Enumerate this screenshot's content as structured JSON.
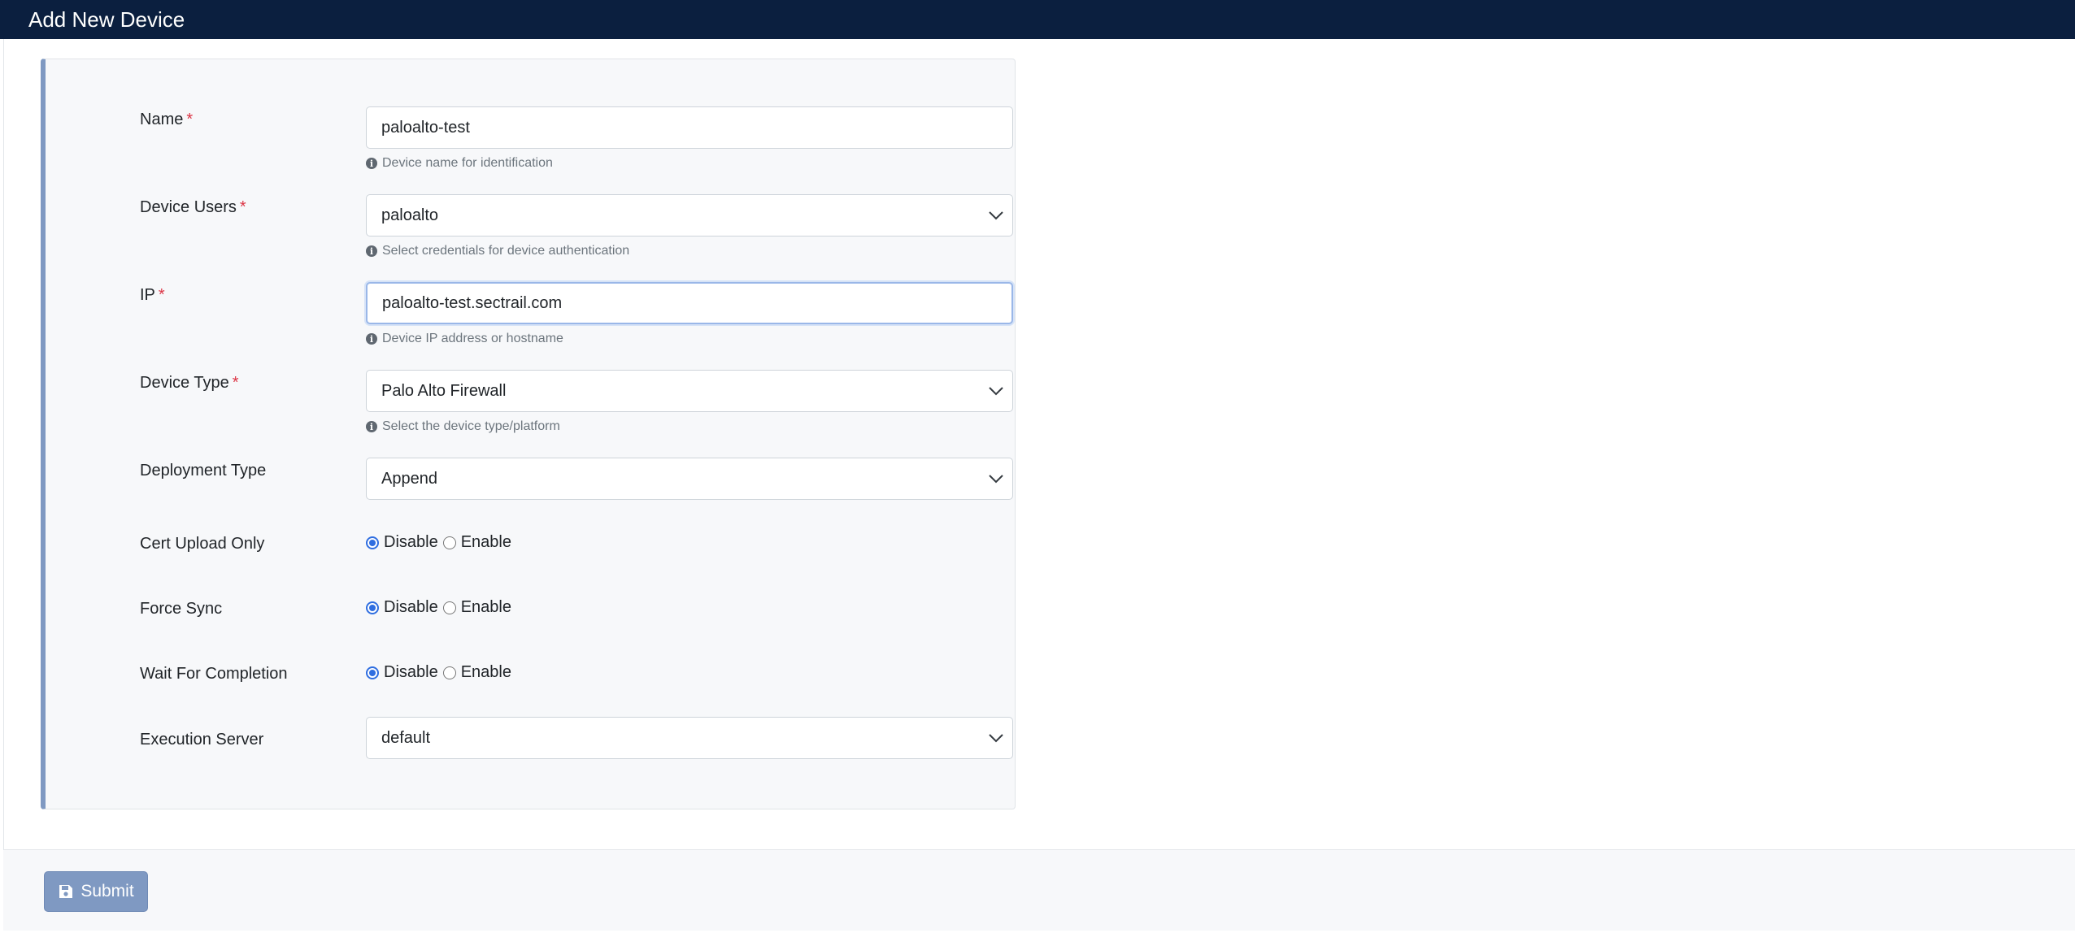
{
  "header": {
    "title": "Add New Device"
  },
  "form": {
    "name": {
      "label": "Name",
      "required": "*",
      "value": "paloalto-test",
      "help": "Device name for identification"
    },
    "device_users": {
      "label": "Device Users",
      "required": "*",
      "value": "paloalto",
      "help": "Select credentials for device authentication"
    },
    "ip": {
      "label": "IP",
      "required": "*",
      "value": "paloalto-test.sectrail.com",
      "help": "Device IP address or hostname"
    },
    "device_type": {
      "label": "Device Type",
      "required": "*",
      "value": "Palo Alto Firewall",
      "help": "Select the device type/platform"
    },
    "deployment_type": {
      "label": "Deployment Type",
      "value": "Append"
    },
    "cert_upload_only": {
      "label": "Cert Upload Only",
      "options": [
        "Disable",
        "Enable"
      ],
      "selected": "Disable"
    },
    "force_sync": {
      "label": "Force Sync",
      "options": [
        "Disable",
        "Enable"
      ],
      "selected": "Disable"
    },
    "wait_for_completion": {
      "label": "Wait For Completion",
      "options": [
        "Disable",
        "Enable"
      ],
      "selected": "Disable"
    },
    "execution_server": {
      "label": "Execution Server",
      "value": "default"
    }
  },
  "footer": {
    "submit_label": "Submit"
  },
  "colors": {
    "header_bg": "#0b1f3f",
    "accent": "#7f99c2",
    "required": "#dc3545",
    "radio_checked": "#2f6ee0"
  },
  "icons": {
    "info": "info-icon",
    "chevron": "chevron-down-icon",
    "save": "save-icon"
  }
}
